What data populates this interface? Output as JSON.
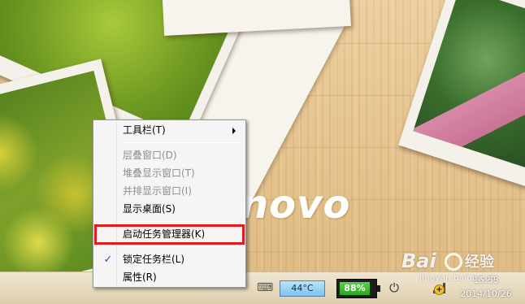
{
  "context_menu": {
    "items": [
      {
        "label": "工具栏(T)",
        "enabled": true,
        "submenu": true
      },
      {
        "label": "层叠窗口(D)",
        "enabled": false
      },
      {
        "label": "堆叠显示窗口(T)",
        "enabled": false
      },
      {
        "label": "并排显示窗口(I)",
        "enabled": false
      },
      {
        "label": "显示桌面(S)",
        "enabled": true
      },
      {
        "label": "启动任务管理器(K)",
        "enabled": true,
        "highlighted": true
      },
      {
        "label": "锁定任务栏(L)",
        "enabled": true,
        "checked": true
      },
      {
        "label": "属性(R)",
        "enabled": true
      }
    ],
    "highlight_color": "#e31b1b"
  },
  "desktop": {
    "logo_text": "novo"
  },
  "tray": {
    "temperature": "44°C",
    "battery_percent": "88%",
    "battery_level": 0.88,
    "keyboard_icon": "keyboard-icon",
    "power_icon": "power-plug-icon",
    "network_icon": "network-warning-icon",
    "warning_glyph": "+"
  },
  "clock": {
    "time": "15:55",
    "date": "2014/10/26"
  },
  "watermark": {
    "brand": "Bai",
    "sub": "经验",
    "url": "jingyan.baidu.com"
  }
}
